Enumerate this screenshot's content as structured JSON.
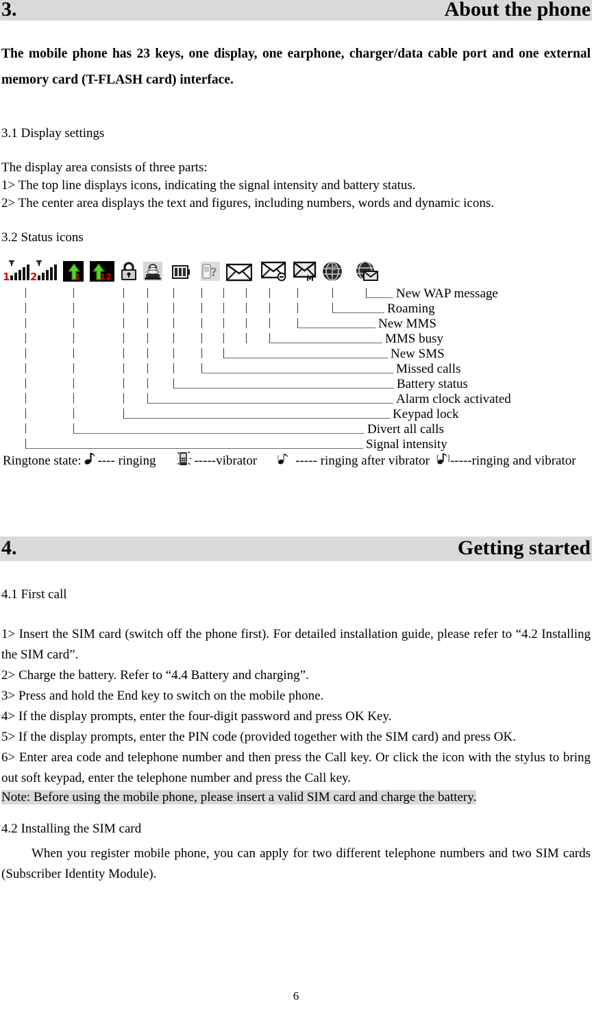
{
  "document": {
    "page_number": "6"
  },
  "chapter3": {
    "number": "3.",
    "title": "About the phone",
    "intro": "The mobile phone has 23 keys, one display, one earphone, charger/data cable port and one external memory card (T-FLASH card) interface.",
    "section_31": {
      "heading": "3.1 Display settings",
      "lead": "The display area consists of three parts:",
      "items": [
        "1> The top line displays icons, indicating the signal intensity and battery status.",
        "2> The center area displays the text and figures, including numbers, words and dynamic icons."
      ]
    },
    "section_32": {
      "heading": "3.2 Status icons",
      "status_icons": [
        {
          "name": "signal-intensity-sim1-icon",
          "label": "Signal intensity"
        },
        {
          "name": "signal-intensity-sim2-icon",
          "label": "Signal intensity"
        },
        {
          "name": "divert-all-calls-sim1-icon",
          "label": "Divert all calls"
        },
        {
          "name": "divert-all-calls-sim2-icon",
          "label": "Divert all calls"
        },
        {
          "name": "keypad-lock-icon",
          "label": "Keypad lock"
        },
        {
          "name": "alarm-clock-icon",
          "label": "Alarm clock activated"
        },
        {
          "name": "battery-status-icon",
          "label": "Battery status"
        },
        {
          "name": "missed-calls-icon",
          "label": "Missed calls"
        },
        {
          "name": "new-sms-icon",
          "label": "New SMS"
        },
        {
          "name": "mms-busy-icon",
          "label": "MMS busy"
        },
        {
          "name": "new-mms-icon",
          "label": "New MMS"
        },
        {
          "name": "roaming-icon",
          "label": "Roaming"
        },
        {
          "name": "new-wap-message-icon",
          "label": "New WAP message"
        }
      ],
      "tree_labels": [
        "New WAP message",
        "Roaming",
        "New MMS",
        "MMS busy",
        "New SMS",
        "Missed calls",
        "Battery status",
        "Alarm clock activated",
        "Keypad lock",
        "Divert all calls",
        "Signal intensity"
      ],
      "ringtone": {
        "prefix": "Ringtone state:",
        "states": [
          {
            "icon": "music-note-icon",
            "text": "---- ringing"
          },
          {
            "icon": "vibrator-phone-icon",
            "text": "-----vibrator"
          },
          {
            "icon": "ring-after-vibrator-icon",
            "text": "----- ringing after vibrator"
          },
          {
            "icon": "ring-and-vibrator-icon",
            "text": "-----ringing and vibrator"
          }
        ]
      }
    }
  },
  "chapter4": {
    "number": "4.",
    "title": "Getting started",
    "section_41": {
      "heading": "4.1 First call",
      "steps": [
        "1> Insert the SIM card (switch off the phone first). For detailed installation guide, please refer to “4.2 Installing the SIM card”.",
        "2> Charge the battery. Refer to “4.4 Battery and charging”.",
        "3> Press and hold the End key to switch on the mobile phone.",
        "4> If the display prompts, enter the four-digit password and press OK Key.",
        "5> If the display prompts, enter the PIN code (provided together with the SIM card) and press OK.",
        "6> Enter area code and telephone number and then press the Call key. Or click the icon with the stylus to bring out soft keypad, enter the telephone number and press the Call key."
      ],
      "note": "Note: Before using the mobile phone, please insert a valid SIM card and charge the battery."
    },
    "section_42": {
      "heading": "4.2 Installing the SIM card",
      "body": "When you register mobile phone, you can apply for two different telephone numbers and two SIM cards (Subscriber Identity Module)."
    }
  },
  "colors": {
    "header_bar": "#d9d9d9",
    "note_highlight": "#d9d9d9",
    "signal_red": "#e00000",
    "divert_green": "#55d427"
  }
}
